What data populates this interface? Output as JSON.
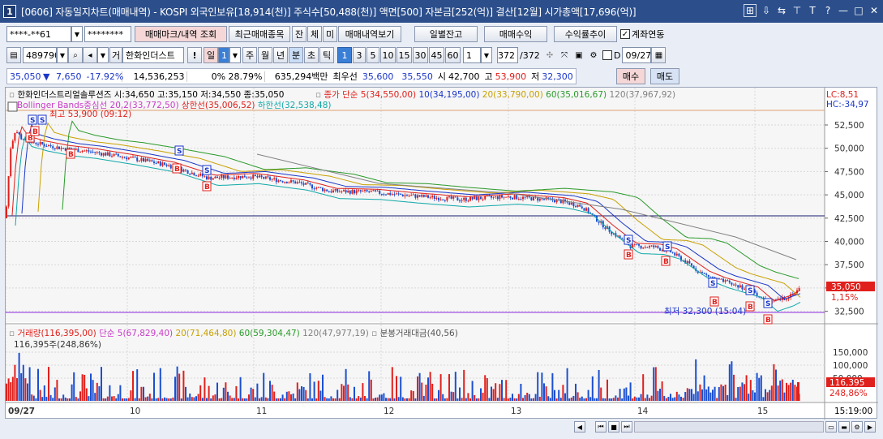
{
  "window": {
    "number": "1",
    "title": "[0606] 자동일지차트(매매내역) - KOSPI 외국인보유[18,914(천)] 주식수[50,488(천)] 액면[500] 자본금[252(억)] 결산[12월] 시가총액[17,696(억)]"
  },
  "toolbar1": {
    "account": "****-**61",
    "password": "********",
    "trade_mark_btn": "매매마크/내역 조회",
    "recent_btn": "최근매매종목",
    "jan_btn": "잔",
    "che_btn": "체",
    "mi_btn": "미",
    "history_btn": "매매내역보기",
    "daily_balance_btn": "일별잔고",
    "profit_btn": "매매수익",
    "return_btn": "수익률추이",
    "link_label": "계좌연동",
    "link_checked": "✓"
  },
  "toolbar2": {
    "code": "489790",
    "geo_label": "거",
    "stock_name": "한화인더스트",
    "excl": "!",
    "il": "일",
    "il_value": "1",
    "periods": [
      "주",
      "월",
      "년",
      "분",
      "초",
      "틱"
    ],
    "intervals": [
      "1",
      "3",
      "5",
      "10",
      "15",
      "30",
      "45",
      "60"
    ],
    "count_value": "1",
    "bars_shown": "372",
    "bars_total": "/372",
    "d_label": "D",
    "date": "09/27"
  },
  "quote": {
    "price": "35,050",
    "arrow": "▼",
    "change": "7,650",
    "rate": "-17.92%",
    "volume": "14,536,253",
    "turnover_ratio": "0% 28.79%",
    "amount": "635,294백만",
    "best_ask_label": "최우선",
    "ask": "35,600",
    "bid": "35,550",
    "open_label": "시",
    "open": "42,700",
    "high_label": "고",
    "high": "53,900",
    "low_label": "저",
    "low": "32,300",
    "buy_btn": "매수",
    "sell_btn": "매도"
  },
  "price_legend": {
    "ohlc": "한화인더스트리얼솔루션즈 시:34,650 고:35,150 저:34,550 종:35,050",
    "ma_header": "종가 단순",
    "ma5": "5(34,550,00)",
    "ma10": "10(34,195,00)",
    "ma20": "20(33,790,00)",
    "ma60": "60(35,016,67)",
    "ma120": "120(37,967,92)",
    "bollinger": "Bollinger Bands중심선 20,2(33,772,50)",
    "upper": "상한선(35,006,52)",
    "lower": "하한선(32,538,48)",
    "high_note": "최고 53,900 (09:12)",
    "low_note": "최저 32,300 (15:04)",
    "lc": "LC:8,51",
    "hc": "HC:-34,97"
  },
  "volume_legend": {
    "vol": "거래량(116,395,00)",
    "ma_header": "단순",
    "ma5": "5(67,829,40)",
    "ma20": "20(71,464,80)",
    "ma60": "60(59,304,47)",
    "ma120": "120(47,977,19)",
    "amount": "분봉거래대금(40,56)",
    "current": "116,395주(248,86%)"
  },
  "y_axis": [
    "52,500",
    "50,000",
    "47,500",
    "45,000",
    "42,500",
    "40,000",
    "37,500",
    "35,000",
    "32,500"
  ],
  "current_price_tag": "35,050",
  "current_pct": "1,15%",
  "vol_axis": [
    "150,000",
    "100,000",
    "50,000"
  ],
  "vol_tag": "116,395",
  "vol_pct": "248,86%",
  "x_axis": [
    "09/27",
    "10",
    "11",
    "12",
    "13",
    "14",
    "15"
  ],
  "time_label": "15:19:00",
  "colors": {
    "up": "#e0201c",
    "down": "#1a4fd0",
    "ma5": "#e0201c",
    "ma10": "#1a36c8",
    "ma20": "#c8a000",
    "ma60": "#2a9a2a",
    "ma120": "#808080",
    "bb_mid": "#c83cc8",
    "bb_up": "#e0201c",
    "bb_low": "#10a8a8",
    "titlebar": "#2c4f8c"
  }
}
